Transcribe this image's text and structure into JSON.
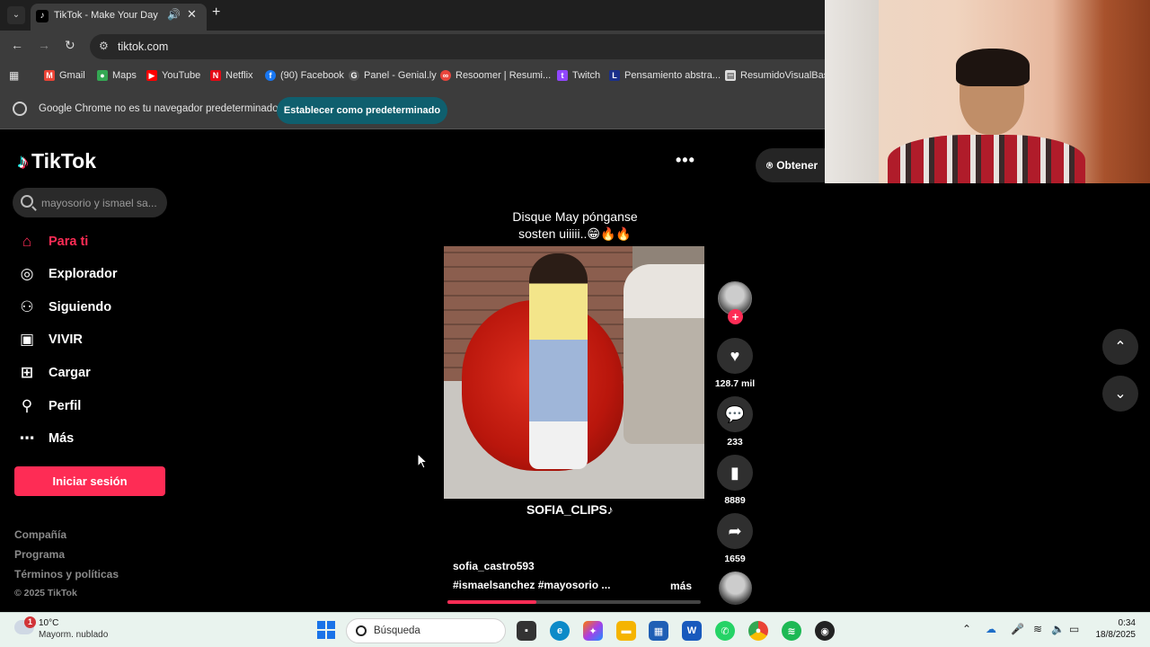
{
  "browser": {
    "tab_title": "TikTok - Make Your Day",
    "url": "tiktok.com",
    "bookmarks": [
      "Gmail",
      "Maps",
      "YouTube",
      "Netflix",
      "(90) Facebook",
      "Panel - Genial.ly",
      "Resoomer | Resumi...",
      "Twitch",
      "Pensamiento abstra...",
      "ResumidoVisualBasi..."
    ],
    "infobar_text": "Google Chrome no es tu navegador predeterminado",
    "infobar_button": "Establecer como predeterminado"
  },
  "tiktok": {
    "logo": "TikTok",
    "search_placeholder": "mayosorio y ismael sa...",
    "nav": [
      "Para ti",
      "Explorador",
      "Siguiendo",
      "VIVIR",
      "Cargar",
      "Perfil",
      "Más"
    ],
    "login_button": "Iniciar sesión",
    "footer": [
      "Compañía",
      "Programa",
      "Términos y políticas",
      "© 2025 TikTok"
    ],
    "get_app": "Obtener",
    "video": {
      "caption_line1": "Disque May pónganse",
      "caption_line2": "sosten uiiiii..😁🔥🔥",
      "watermark": "SOFIA_CLIPS♪",
      "author": "sofia_castro593",
      "hashtags": "#ismaelsanchez  #mayosorio  ...",
      "more": "más",
      "progress": 0.35
    },
    "actions": {
      "likes": "128.7 mil",
      "comments": "233",
      "saves": "8889",
      "shares": "1659"
    }
  },
  "taskbar": {
    "temperature": "10°C",
    "weather": "Mayorm. nublado",
    "weather_badge": "1",
    "search": "Búsqueda",
    "time": "0:34",
    "date": "18/8/2025"
  },
  "colors": {
    "tiktok_red": "#fe2c55",
    "chrome_dark": "#3c3c3c",
    "infobar_button": "#0f5f6e"
  }
}
